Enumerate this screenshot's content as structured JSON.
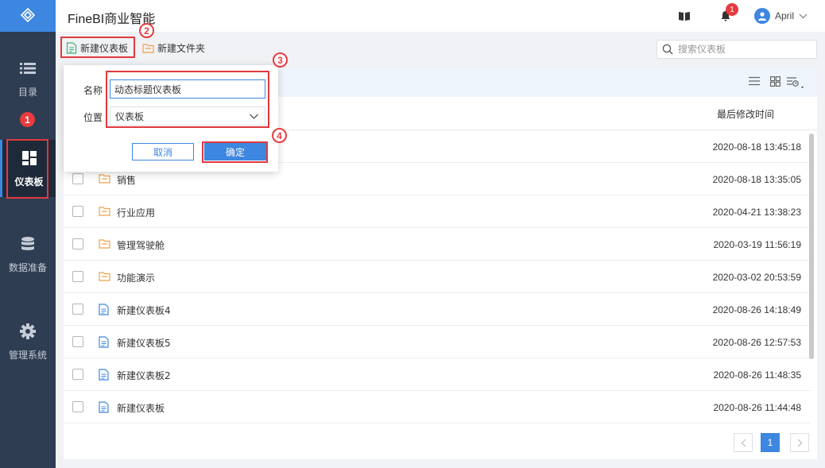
{
  "app": {
    "title": "FineBI商业智能"
  },
  "header": {
    "notification_count": "1",
    "user_name": "April"
  },
  "sidebar": {
    "items": [
      {
        "label": "目录",
        "icon": "list-icon"
      },
      {
        "label": "仪表板",
        "icon": "dashboard-icon"
      },
      {
        "label": "数据准备",
        "icon": "database-icon"
      },
      {
        "label": "管理系统",
        "icon": "gear-icon"
      }
    ]
  },
  "toolbar": {
    "new_dashboard_label": "新建仪表板",
    "new_folder_label": "新建文件夹",
    "search_placeholder": "搜索仪表板"
  },
  "table": {
    "modified_header": "最后修改时间",
    "rows": [
      {
        "type": "folder",
        "name": "",
        "modified": "2020-08-18 13:45:18"
      },
      {
        "type": "folder",
        "name": "销售",
        "modified": "2020-08-18 13:35:05"
      },
      {
        "type": "folder",
        "name": "行业应用",
        "modified": "2020-04-21 13:38:23"
      },
      {
        "type": "folder",
        "name": "管理驾驶舱",
        "modified": "2020-03-19 11:56:19"
      },
      {
        "type": "folder",
        "name": "功能演示",
        "modified": "2020-03-02 20:53:59"
      },
      {
        "type": "dashboard",
        "name": "新建仪表板4",
        "modified": "2020-08-26 14:18:49"
      },
      {
        "type": "dashboard",
        "name": "新建仪表板5",
        "modified": "2020-08-26 12:57:53"
      },
      {
        "type": "dashboard",
        "name": "新建仪表板2",
        "modified": "2020-08-26 11:48:35"
      },
      {
        "type": "dashboard",
        "name": "新建仪表板",
        "modified": "2020-08-26 11:44:48"
      }
    ]
  },
  "pagination": {
    "current_page": "1"
  },
  "dialog": {
    "name_label": "名称",
    "name_value": "动态标题仪表板",
    "location_label": "位置",
    "location_value": "仪表板",
    "cancel_label": "取消",
    "ok_label": "确定"
  },
  "annotations": [
    "1",
    "2",
    "3",
    "4"
  ],
  "colors": {
    "accent": "#3d87e0",
    "sidebar": "#2e3d52",
    "annotation": "#e83b3f",
    "folder": "#f0a04b",
    "dashboard_file": "#3d87e0"
  }
}
